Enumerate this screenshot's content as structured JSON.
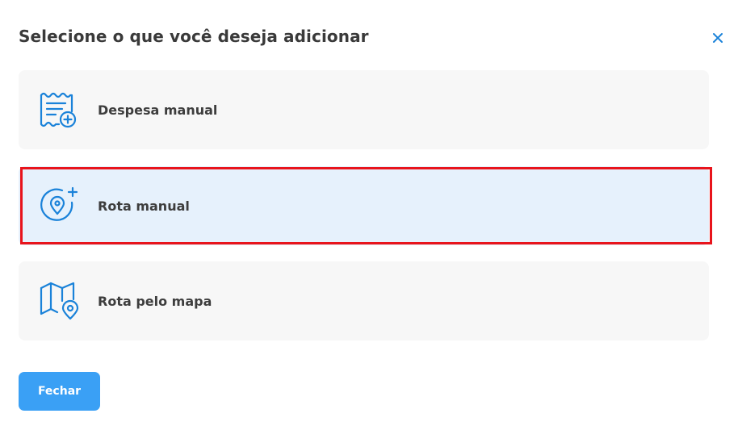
{
  "dialog": {
    "title": "Selecione o que você deseja adicionar",
    "close_icon": "close-icon"
  },
  "options": [
    {
      "label": "Despesa manual",
      "icon": "receipt-add-icon",
      "selected": false
    },
    {
      "label": "Rota manual",
      "icon": "location-add-icon",
      "selected": true
    },
    {
      "label": "Rota pelo mapa",
      "icon": "map-pin-icon",
      "selected": false
    }
  ],
  "footer": {
    "close_label": "Fechar"
  },
  "colors": {
    "accent": "#1a82d9",
    "button": "#3aa0f5",
    "selected_bg": "#e6f1fc",
    "highlight": "#e8141c"
  }
}
